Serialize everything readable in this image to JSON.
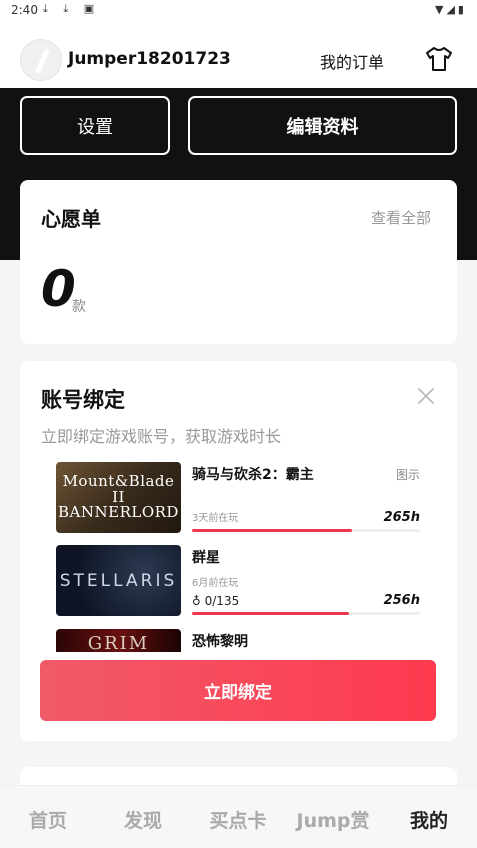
{
  "status_bar": {
    "time": "2:40",
    "left_icons": "⤓ ⤓ ▣",
    "right_icons": "▼◢▮"
  },
  "header": {
    "username": "Jumper18201723",
    "orders_label": "我的订单"
  },
  "profile_actions": {
    "settings_label": "设置",
    "edit_label": "编辑资料"
  },
  "wishlist": {
    "title": "心愿单",
    "view_all": "查看全部",
    "count": "0",
    "unit": "款"
  },
  "account_binding": {
    "title": "账号绑定",
    "subtitle": "立即绑定游戏账号，获取游戏时长",
    "games": [
      {
        "name": "骑马与砍杀2：霸主",
        "thumb_text": "Mount&Blade II BANNERLORD",
        "tag": "图示",
        "last_played": "3天前在玩",
        "hours": "265h",
        "progress": 0.7
      },
      {
        "name": "群星",
        "thumb_text": "STELLARIS",
        "last_played": "6月前在玩",
        "achievements": "0/135",
        "hours": "256h",
        "progress": 0.69
      },
      {
        "name": "恐怖黎明",
        "thumb_text": "GRIM"
      }
    ],
    "bind_button": "立即绑定"
  },
  "tabs": [
    {
      "label": "首页"
    },
    {
      "label": "发现"
    },
    {
      "label": "买点卡"
    },
    {
      "label": "Jump赏"
    },
    {
      "label": "我的"
    }
  ],
  "colors": {
    "accent": "#f0364d",
    "dark_band": "#111111"
  }
}
